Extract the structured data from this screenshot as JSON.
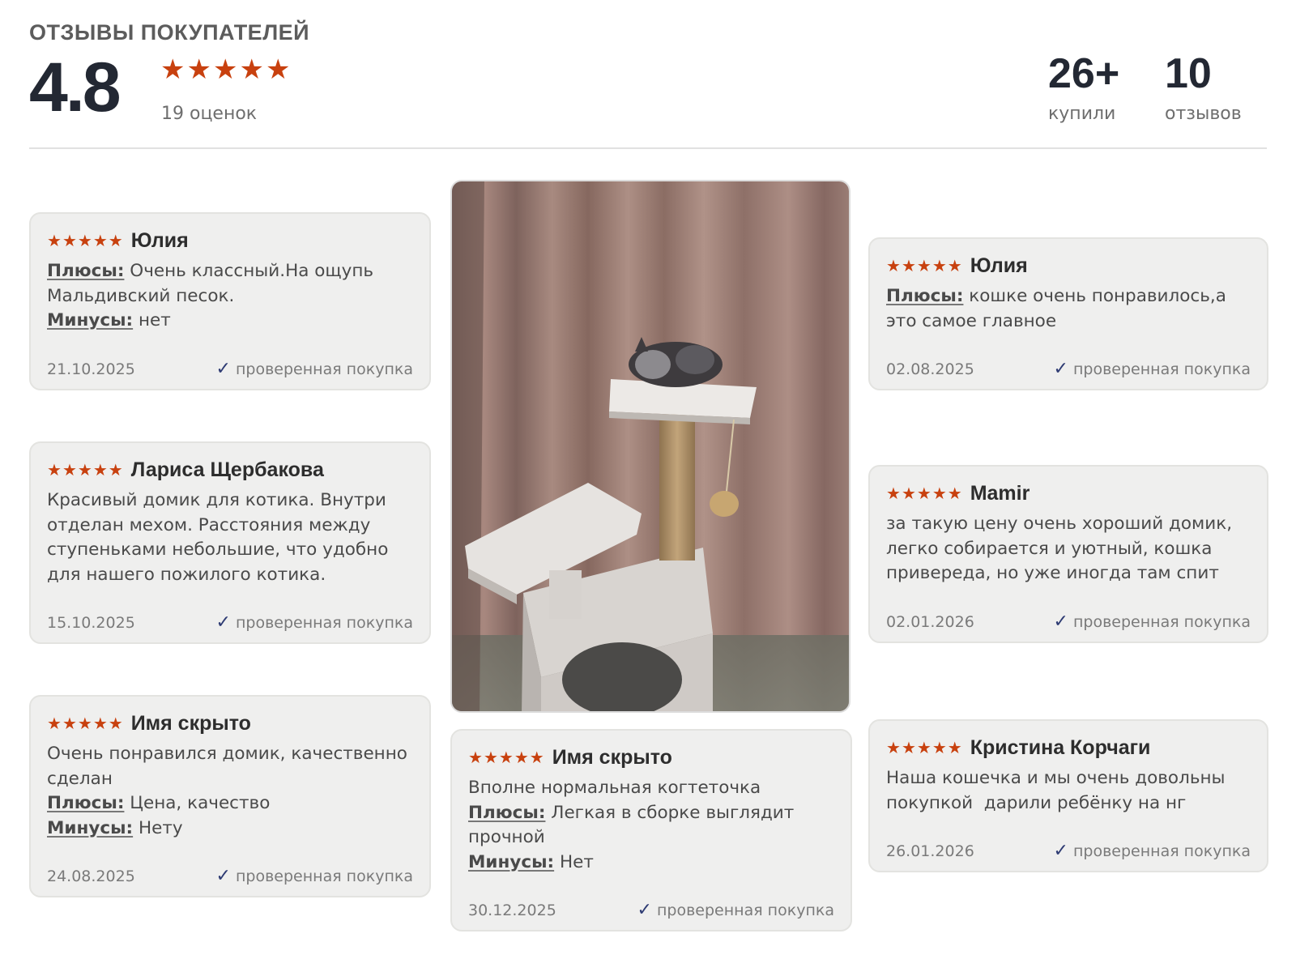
{
  "header": {
    "title": "ОТЗЫВЫ ПОКУПАТЕЛЕЙ",
    "rating": "4.8",
    "rating_stars": 5,
    "rating_count": "19 оценок",
    "bought_value": "26+",
    "bought_label": "купили",
    "reviews_value": "10",
    "reviews_label": "отзывов"
  },
  "colors": {
    "star": "#c8410f",
    "check": "#2e3b73",
    "card_bg": "#efefee"
  },
  "icons": {
    "star": "star-icon",
    "verified": "check-icon"
  },
  "photo": {
    "alt": "кошка на когтеточке-домике"
  },
  "reviews": [
    {
      "stars": 5,
      "name": "Юлия",
      "plus_label": "Плюсы:",
      "plus": " Очень классный.На ощупь Мальдивский песок.",
      "minus_label": "Минусы:",
      "minus": " нет",
      "date": "21.10.2025",
      "verified": "проверенная покупка"
    },
    {
      "stars": 5,
      "name": "Лариса Щербакова",
      "text": "Красивый домик для котика. Внутри отделан мехом. Расстояния между ступеньками небольшие, что удобно для нашего пожилого котика.",
      "date": "15.10.2025",
      "verified": "проверенная покупка"
    },
    {
      "stars": 5,
      "name": "Имя скрыто",
      "text": "Очень понравился домик, качественно сделан",
      "plus_label": "Плюсы:",
      "plus": " Цена, качество",
      "minus_label": "Минусы:",
      "minus": " Нету",
      "date": "24.08.2025",
      "verified": "проверенная покупка"
    },
    {
      "stars": 5,
      "name": "Имя скрыто",
      "text": "Вполне нормальная когтеточка",
      "plus_label": "Плюсы:",
      "plus": " Легкая в сборке выглядит прочной",
      "minus_label": "Минусы:",
      "minus": " Нет",
      "date": "30.12.2025",
      "verified": "проверенная покупка"
    },
    {
      "stars": 5,
      "name": "Юлия",
      "plus_label": "Плюсы:",
      "plus": " кошке очень понравилось,а это самое главное",
      "date": "02.08.2025",
      "verified": "проверенная покупка"
    },
    {
      "stars": 5,
      "name": "Mamir",
      "text": "за такую цену очень хороший домик, легко собирается и уютный, кошка привереда, но уже иногда там спит",
      "date": "02.01.2026",
      "verified": "проверенная покупка"
    },
    {
      "stars": 5,
      "name": "Кристина Корчаги",
      "text": "Наша кошечка и мы очень довольны покупкой  дарили ребёнку на нг",
      "date": "26.01.2026",
      "verified": "проверенная покупка"
    }
  ]
}
